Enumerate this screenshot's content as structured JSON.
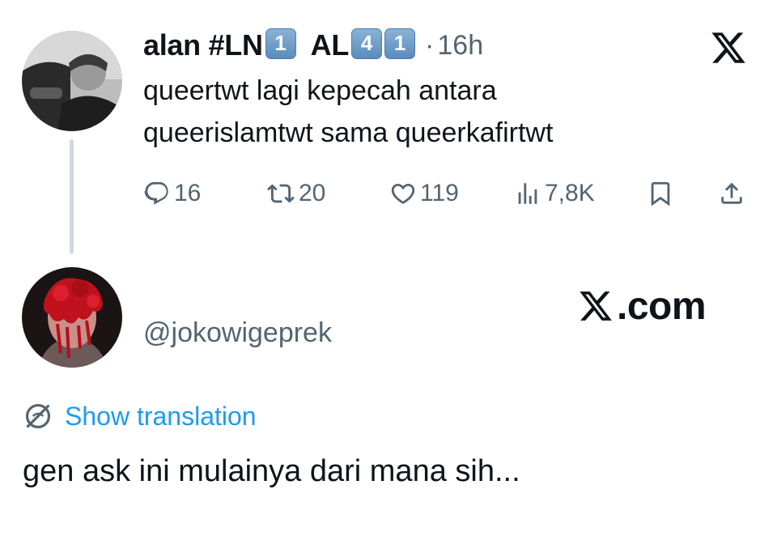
{
  "tweet": {
    "author_name": "alan #LN",
    "keycap_1": "1",
    "author_suffix": "AL",
    "keycap_2": "4",
    "keycap_3": "1",
    "separator": "·",
    "time": "16h",
    "text_line_1": "queertwt lagi kepecah antara",
    "text_line_2": "queerislamtwt sama queerkafirtwt",
    "actions": {
      "replies": "16",
      "retweets": "20",
      "likes": "119",
      "views": "7,8K"
    }
  },
  "brand": {
    "x_logo_icon": "x-logo-icon",
    "domain_text": ".com"
  },
  "reply": {
    "handle": "@jokowigeprek",
    "show_translation_label": "Show translation",
    "text": "gen ask ini mulainya dari mana sih..."
  },
  "colors": {
    "text": "#0f1419",
    "muted": "#536471",
    "link": "#1d9bf0",
    "thread_line": "#cfd9de",
    "keycap": "#6a9bc8"
  },
  "icons": [
    "reply-icon",
    "retweet-icon",
    "like-icon",
    "views-icon",
    "bookmark-icon",
    "share-icon",
    "translate-icon",
    "x-logo-icon"
  ]
}
